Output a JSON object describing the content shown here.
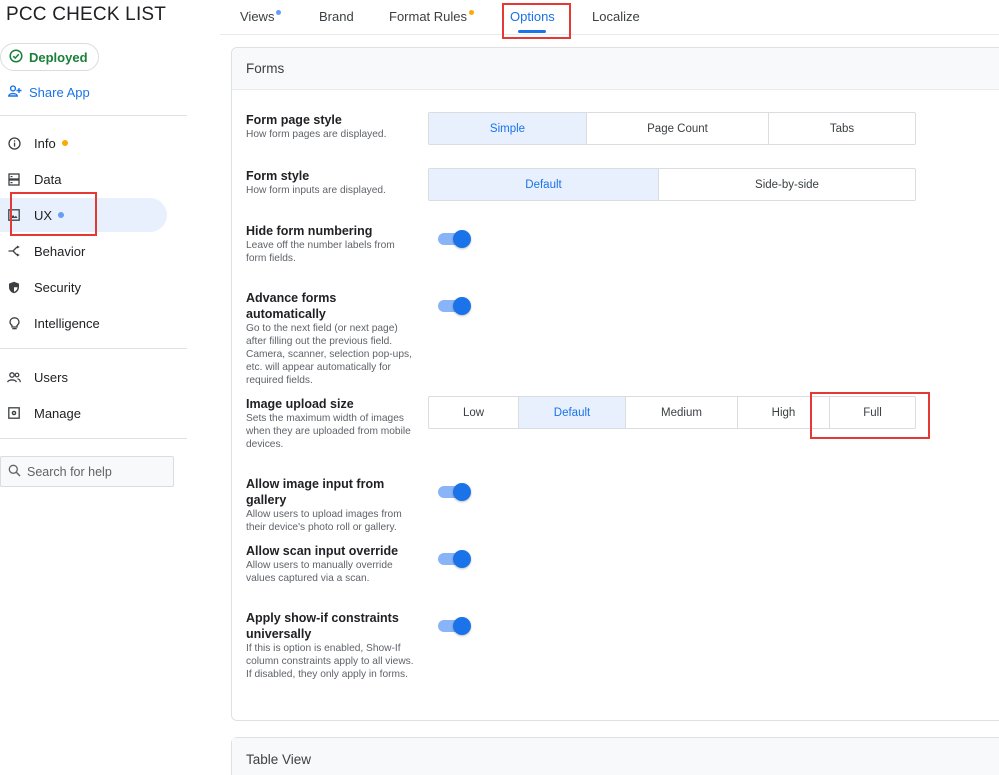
{
  "app": {
    "title": "PCC CHECK LIST"
  },
  "status": {
    "deployed_label": "Deployed",
    "share_label": "Share App"
  },
  "sidebar": {
    "items": [
      {
        "label": "Info",
        "icon": "info-icon",
        "dot": "orange"
      },
      {
        "label": "Data",
        "icon": "database-icon"
      },
      {
        "label": "UX",
        "icon": "image-icon",
        "dot": "blue",
        "active": true
      },
      {
        "label": "Behavior",
        "icon": "share-branch-icon"
      },
      {
        "label": "Security",
        "icon": "shield-icon"
      },
      {
        "label": "Intelligence",
        "icon": "lightbulb-icon"
      },
      {
        "label": "Users",
        "icon": "users-icon"
      },
      {
        "label": "Manage",
        "icon": "settings-box-icon"
      }
    ],
    "search_placeholder": "Search for help"
  },
  "tabs": [
    {
      "label": "Views",
      "dot": "blue"
    },
    {
      "label": "Brand"
    },
    {
      "label": "Format Rules",
      "dot": "orange"
    },
    {
      "label": "Options",
      "active": true
    },
    {
      "label": "Localize"
    }
  ],
  "forms": {
    "header": "Forms",
    "form_page_style": {
      "title": "Form page style",
      "desc": "How form pages are displayed.",
      "options": [
        "Simple",
        "Page Count",
        "Tabs"
      ],
      "selected": "Simple"
    },
    "form_style": {
      "title": "Form style",
      "desc": "How form inputs are displayed.",
      "options": [
        "Default",
        "Side-by-side"
      ],
      "selected": "Default"
    },
    "hide_numbering": {
      "title": "Hide form numbering",
      "desc": "Leave off the number labels from form fields."
    },
    "advance_auto": {
      "title": "Advance forms automatically",
      "desc": "Go to the next field (or next page) after filling out the previous field. Camera, scanner, selection pop-ups, etc. will appear automatically for required fields."
    },
    "image_upload": {
      "title": "Image upload size",
      "desc": "Sets the maximum width of images when they are uploaded from mobile devices.",
      "options": [
        "Low",
        "Default",
        "Medium",
        "High",
        "Full"
      ],
      "selected": "Default"
    },
    "gallery": {
      "title": "Allow image input from gallery",
      "desc": "Allow users to upload images from their device's photo roll or gallery."
    },
    "scan_override": {
      "title": "Allow scan input override",
      "desc": "Allow users to manually override values captured via a scan."
    },
    "show_if": {
      "title": "Apply show-if constraints universally",
      "desc": "If this is option is enabled, Show-If column constraints apply to all views. If disabled, they only apply in forms."
    }
  },
  "table_view": {
    "header": "Table View"
  },
  "colors": {
    "accent": "#1a73e8",
    "deployed": "#188038",
    "annotation": "#e53935"
  }
}
